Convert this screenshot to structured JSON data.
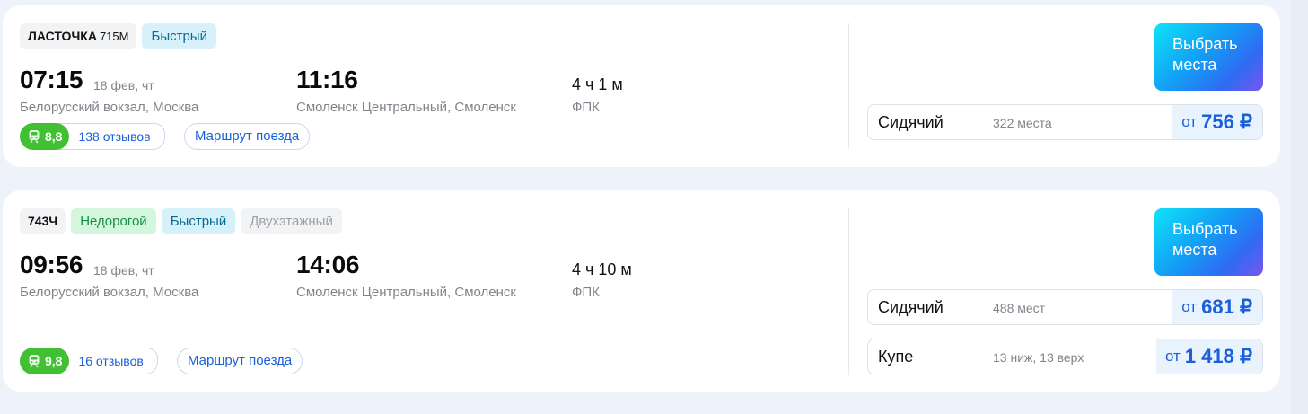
{
  "trips": [
    {
      "train": "ЛАСТОЧКА",
      "train_model": "715М",
      "badges": [
        "Быстрый"
      ],
      "depart_time": "07:15",
      "depart_date": "18 фев, чт",
      "depart_station": "Белорусский вокзал, Москва",
      "arrive_time": "11:16",
      "arrive_station": "Смоленск Центральный, Смоленск",
      "duration": "4 ч 1 м",
      "carrier": "ФПК",
      "rating": "8,8",
      "reviews": "138 отзывов",
      "route_label": "Маршрут поезда",
      "select_label": "Выбрать места",
      "fares": [
        {
          "class": "Сидячий",
          "seats": "322 места",
          "from": "от",
          "price": "756 ₽"
        }
      ]
    },
    {
      "train": "743Ч",
      "badges": [
        "Недорогой",
        "Быстрый",
        "Двухэтажный"
      ],
      "depart_time": "09:56",
      "depart_date": "18 фев, чт",
      "depart_station": "Белорусский вокзал, Москва",
      "arrive_time": "14:06",
      "arrive_station": "Смоленск Центральный, Смоленск",
      "duration": "4 ч 10 м",
      "carrier": "ФПК",
      "rating": "9,8",
      "reviews": "16 отзывов",
      "route_label": "Маршрут поезда",
      "select_label": "Выбрать места",
      "fares": [
        {
          "class": "Сидячий",
          "seats": "488 мест",
          "from": "от",
          "price": "681 ₽"
        },
        {
          "class": "Купе",
          "seats": "13 ниж, 13 верх",
          "from": "от",
          "price": "1 418 ₽"
        }
      ]
    }
  ],
  "colors": {
    "accent": "#1b5fd9",
    "rating_green": "#42c033",
    "fast_badge_bg": "#d6f1fa",
    "cheap_badge_bg": "#d4f6df",
    "page_bg": "#edf2fb"
  },
  "icons": {
    "rating": "train-front-icon"
  }
}
